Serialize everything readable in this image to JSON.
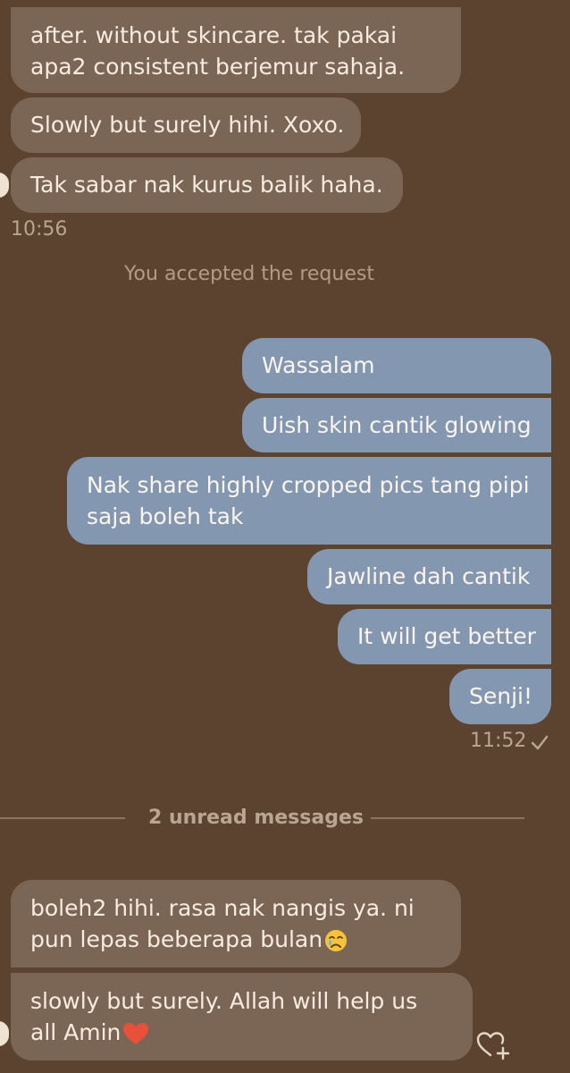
{
  "conversation": {
    "older_received": [
      "after. without skincare. tak pakai",
      "apa2 consistent berjemur sahaja.",
      "Slowly but surely hihi. Xoxo.",
      "Tak sabar nak kurus balik haha."
    ],
    "older_time": "10:56",
    "system_notice": "You accepted the request",
    "sent": [
      "Wassalam",
      "Uish skin cantik glowing",
      "Nak share highly cropped pics tang pipi",
      "saja boleh tak",
      "Jawline dah cantik",
      "It will get better",
      "Senji!"
    ],
    "sent_time": "11:52",
    "sent_status_icon": "check-icon",
    "unread_label": "2 unread messages",
    "new_received": [
      "boleh2 hihi. rasa nak nangis ya. ni",
      "pun lepas beberapa bulan",
      "slowly but surely. Allah will help us",
      "all Amin"
    ],
    "emojis": {
      "crying": "crying-face-icon",
      "heart": "red-heart-icon"
    },
    "react_icon": "heart-add-icon"
  },
  "colors": {
    "background": "#5c4330",
    "received_bubble": "#7b6656",
    "sent_bubble": "#8497b0",
    "text_light": "#f7ece0",
    "muted": "#b8a592"
  }
}
